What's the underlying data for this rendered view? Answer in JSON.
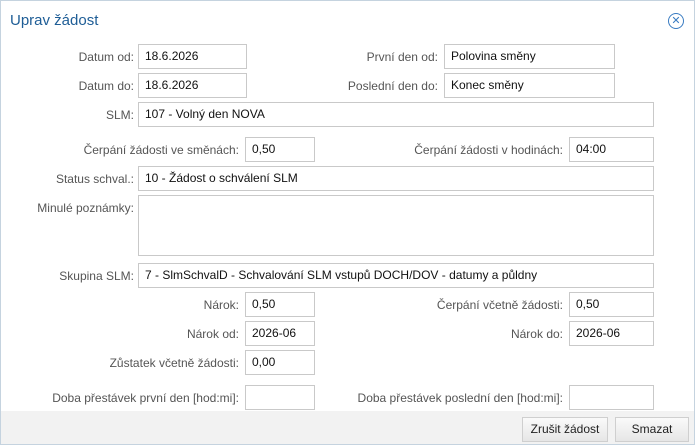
{
  "dialog": {
    "title": "Uprav žádost"
  },
  "form": {
    "datum_od": {
      "label": "Datum od:",
      "value": "18.6.2026"
    },
    "prvni_den_od": {
      "label": "První den od:",
      "value": "Polovina směny"
    },
    "datum_do": {
      "label": "Datum do:",
      "value": "18.6.2026"
    },
    "posledni_den_do": {
      "label": "Poslední den do:",
      "value": "Konec směny"
    },
    "slm": {
      "label": "SLM:",
      "value": "107 - Volný den NOVA"
    },
    "cerpani_smeny": {
      "label": "Čerpání žádosti ve směnách:",
      "value": "0,50"
    },
    "cerpani_hodiny": {
      "label": "Čerpání žádosti v hodinách:",
      "value": "04:00"
    },
    "status": {
      "label": "Status schval.:",
      "value": "10 - Žádost o schválení SLM"
    },
    "minule_poznamky": {
      "label": "Minulé poznámky:",
      "value": ""
    },
    "skupina_slm": {
      "label": "Skupina SLM:",
      "value": "7 - SlmSchvalD - Schvalování SLM vstupů DOCH/DOV - datumy a půldny"
    },
    "narok": {
      "label": "Nárok:",
      "value": "0,50"
    },
    "cerpani_vcetne": {
      "label": "Čerpání včetně žádosti:",
      "value": "0,50"
    },
    "narok_od": {
      "label": "Nárok od:",
      "value": "2026-06"
    },
    "narok_do": {
      "label": "Nárok do:",
      "value": "2026-06"
    },
    "zustatek": {
      "label": "Zůstatek včetně žádosti:",
      "value": "0,00"
    },
    "prestavky_prvni": {
      "label": "Doba přestávek první den [hod:mi]:",
      "value": ""
    },
    "prestavky_posledni": {
      "label": "Doba přestávek poslední den [hod:mi]:",
      "value": ""
    }
  },
  "buttons": {
    "cancel_request": "Zrušit žádost",
    "delete": "Smazat"
  }
}
